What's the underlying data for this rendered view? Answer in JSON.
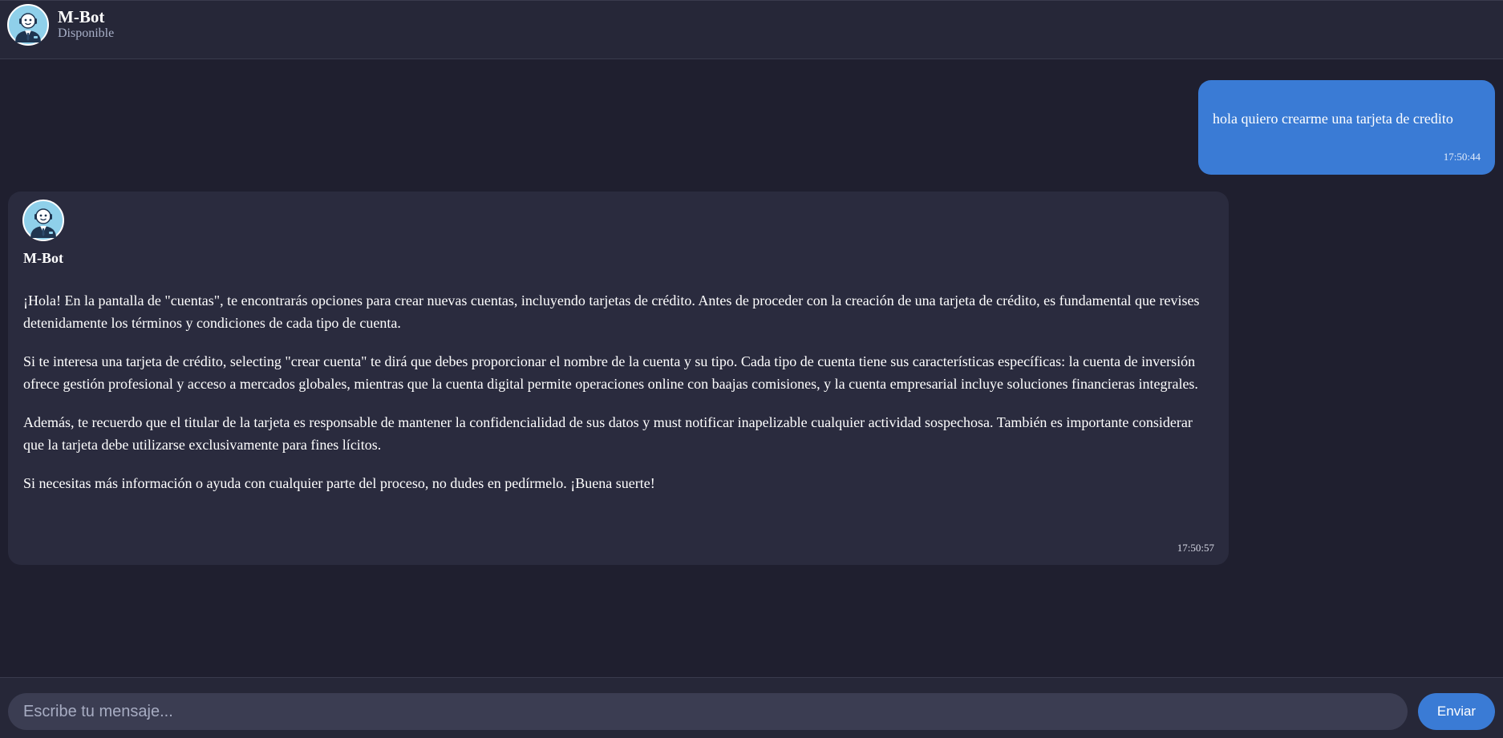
{
  "header": {
    "title": "M-Bot",
    "status": "Disponible",
    "avatar_icon": "bot-avatar-icon"
  },
  "messages": {
    "user": {
      "text": "hola quiero crearme una tarjeta de credito",
      "time": "17:50:44"
    },
    "bot": {
      "name": "M-Bot",
      "paragraphs": [
        "¡Hola! En la pantalla de \"cuentas\", te encontrarás opciones para crear nuevas cuentas, incluyendo tarjetas de crédito. Antes de proceder con la creación de una tarjeta de crédito, es fundamental que revises detenidamente los términos y condiciones de cada tipo de cuenta.",
        "Si te interesa una tarjeta de crédito, selecting \"crear cuenta\" te dirá que debes proporcionar el nombre de la cuenta y su tipo. Cada tipo de cuenta tiene sus características específicas: la cuenta de inversión ofrece gestión profesional y acceso a mercados globales, mientras que la cuenta digital permite operaciones online con baajas comisiones, y la cuenta empresarial incluye soluciones financieras integrales.",
        "Además, te recuerdo que el titular de la tarjeta es responsable de mantener la confidencialidad de sus datos y must notificar inapelizable cualquier actividad sospechosa. También es importante considerar que la tarjeta debe utilizarse exclusivamente para fines lícitos.",
        "Si necesitas más información o ayuda con cualquier parte del proceso, no dudes en pedírmelo. ¡Buena suerte!"
      ],
      "time": "17:50:57"
    }
  },
  "composer": {
    "placeholder": "Escribe tu mensaje...",
    "value": "",
    "send_label": "Enviar"
  },
  "colors": {
    "background": "#1f1f2f",
    "header": "#262738",
    "bot_bubble": "#2a2b3e",
    "user_bubble": "#3a7bd5",
    "accent": "#3a7bd5",
    "input": "#3b3d52"
  }
}
